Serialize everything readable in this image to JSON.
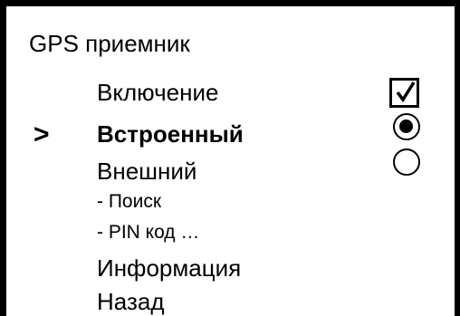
{
  "screen": {
    "title": "GPS приемник",
    "cursor": ">"
  },
  "menu": {
    "items": [
      {
        "label": "Включение",
        "control": "checkbox",
        "checked": true
      },
      {
        "label": "Встроенный",
        "control": "radio",
        "selected": true,
        "highlighted": true
      },
      {
        "label": "Внешний",
        "control": "radio",
        "selected": false
      },
      {
        "label": "- Поиск"
      },
      {
        "label": "- PIN код …"
      },
      {
        "label": "Информация"
      },
      {
        "label": "Назад"
      }
    ]
  }
}
